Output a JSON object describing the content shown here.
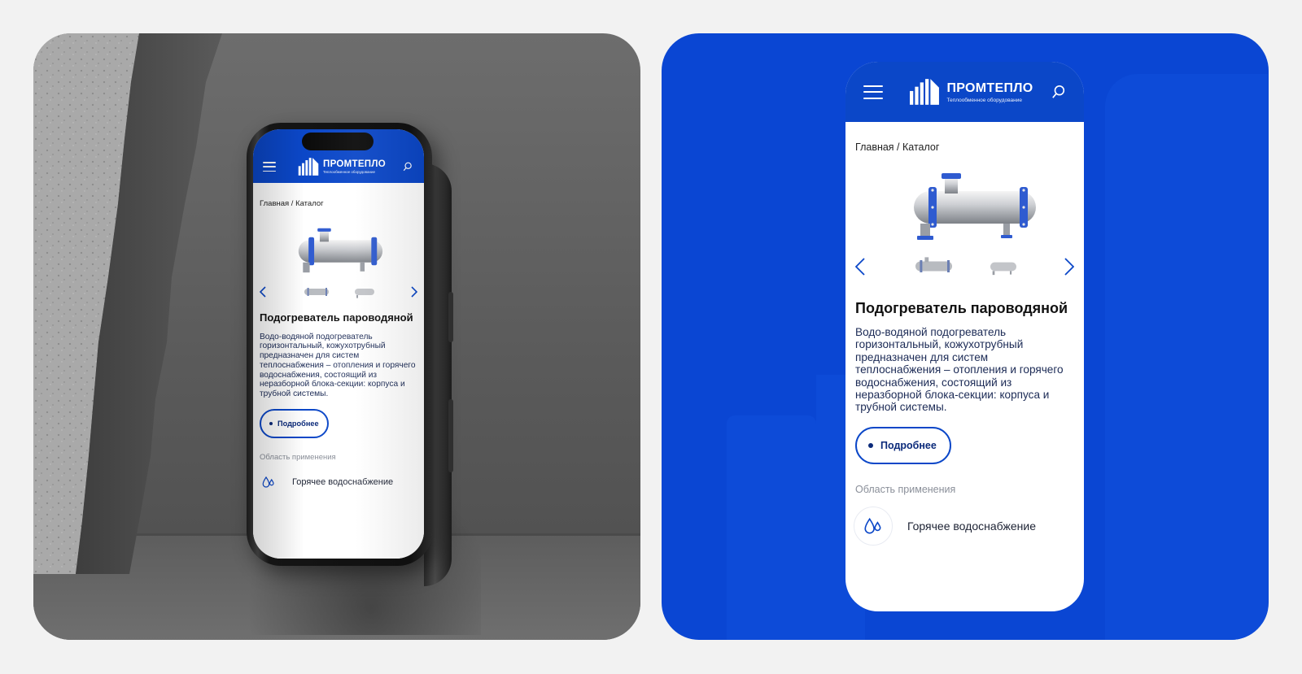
{
  "colors": {
    "brand_blue": "#0b47c8",
    "panel_blue": "#0a46d3",
    "background": "#f2f2f2"
  },
  "header": {
    "menu_icon": "burger-menu-icon",
    "logo_icon": "factory-buildings-logo",
    "brand_name": "ПРОМТЕПЛО",
    "brand_tagline": "Теплообменное оборудование",
    "search_icon": "search-icon"
  },
  "breadcrumb": "Главная / Каталог",
  "product": {
    "image_icon": "heat-exchanger-image",
    "gallery": {
      "prev_icon": "chevron-left-icon",
      "next_icon": "chevron-right-icon",
      "thumbnail_count": 2
    },
    "title": "Подогреватель пароводяной",
    "description": "Водо-водяной подогреватель горизонтальный, кожухотрубный предназначен для систем теплоснабжения – отопления и горячего водоснабжения, состоящий из неразборной блока-секции: корпуса и трубной системы.",
    "more_button": "Подробнее"
  },
  "application": {
    "label": "Область применения",
    "items": [
      {
        "icon": "water-drops-icon",
        "text": "Горячее водоснабжение"
      }
    ]
  }
}
